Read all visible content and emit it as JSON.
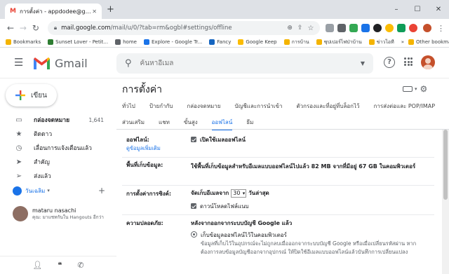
{
  "browser": {
    "tab_title": "การตั้งค่า - appdodee@gmail.com",
    "address_host": "mail.google.com",
    "address_path": "/mail/u/0/?tab=rm&ogbl#settings/offline",
    "window_controls": [
      "–",
      "☐",
      "✕"
    ]
  },
  "bookmarks": [
    {
      "label": "Bookmarks",
      "color": "#f4b400"
    },
    {
      "label": "Sunset Lover - Petit...",
      "color": "#2e7d32"
    },
    {
      "label": "home",
      "color": "#5f6368"
    },
    {
      "label": "Explore - Google Tr...",
      "color": "#1a73e8"
    },
    {
      "label": "Fancy",
      "color": "#1565c0"
    },
    {
      "label": "Google Keep",
      "color": "#fbbc04"
    },
    {
      "label": "การบ้าน",
      "color": "#f4b400"
    },
    {
      "label": "ซุปเปอร์ไฟป่าบ้าน",
      "color": "#f4b400"
    },
    {
      "label": "ข่าวไอที",
      "color": "#f4b400"
    },
    {
      "label": "Other bookmarks",
      "color": "#f4b400"
    }
  ],
  "header": {
    "app_name": "Gmail",
    "search_placeholder": "ค้นหาอีเมล"
  },
  "sidebar": {
    "compose_label": "เขียน",
    "items": [
      {
        "label": "กล่องจดหมาย",
        "count": "1,641",
        "icon": "inbox-icon",
        "glyph": "▭"
      },
      {
        "label": "ติดดาว",
        "count": "",
        "icon": "star-icon",
        "glyph": "★"
      },
      {
        "label": "เลื่อนการแจ้งเตือนแล้ว",
        "count": "",
        "icon": "clock-icon",
        "glyph": "◷"
      },
      {
        "label": "สำคัญ",
        "count": "",
        "icon": "label-important-icon",
        "glyph": "➤"
      },
      {
        "label": "ส่งแล้ว",
        "count": "",
        "icon": "send-icon",
        "glyph": "➢"
      }
    ],
    "hangouts_name": "วันเฉลิม",
    "chat_name": "mataru nasachi",
    "chat_status": "คุณ: มาแชทกันใน Hangouts อีกว่า"
  },
  "settings": {
    "title": "การตั้งค่า",
    "tabs_row1": [
      "ทั่วไป",
      "ป้ายกำกับ",
      "กล่องจดหมาย",
      "บัญชีและการนำเข้า",
      "ตัวกรองและที่อยู่ที่บล็อกไว้",
      "การส่งต่อและ POP/IMAP"
    ],
    "tabs_row2": [
      "ส่วนเสริม",
      "แชท",
      "ขั้นสูง",
      "ออฟไลน์",
      "ธีม"
    ],
    "offline_label": "ออฟไลน์:",
    "learn_more": "ดูข้อมูลเพิ่มเติม",
    "enable_offline": "เปิดใช้เมลออฟไลน์",
    "storage_label": "พื้นที่เก็บข้อมูล:",
    "storage_text": "ใช้พื้นที่เก็บข้อมูลสำหรับอีเมลแบบออฟไลน์ไปแล้ว 82 MB จากที่มีอยู่ 67 GB ในคอมพิวเตอร์",
    "sync_label": "การตั้งค่าการซิงค์:",
    "sync_prefix": "จัดเก็บอีเมลจาก",
    "sync_days": "30",
    "sync_suffix": "วันล่าสุด",
    "download_attachments": "ดาวน์โหลดไฟล์แนบ",
    "security_label": "ความปลอดภัย:",
    "security_heading": "หลังจากออกจากระบบบัญชี Google แล้ว",
    "keep_data": "เก็บข้อมูลออฟไลน์ไว้ในคอมพิวเตอร์",
    "keep_data_desc": "ข้อมูลที่เก็บไว้ในอุปกรณ์จะไม่ถูกลบเมื่อออกจากระบบบัญชี Google หรือเมื่อเปลี่ยนรหัสผ่าน หากต้องการลบข้อมูลบัญชีออกจากอุปกรณ์ ให้ปิดใช้อีเมลแบบออฟไลน์แล้วบันทึกการเปลี่ยนแปลง"
  },
  "colors": {
    "accent": "#1a73e8",
    "gmail_red": "#ea4335"
  }
}
